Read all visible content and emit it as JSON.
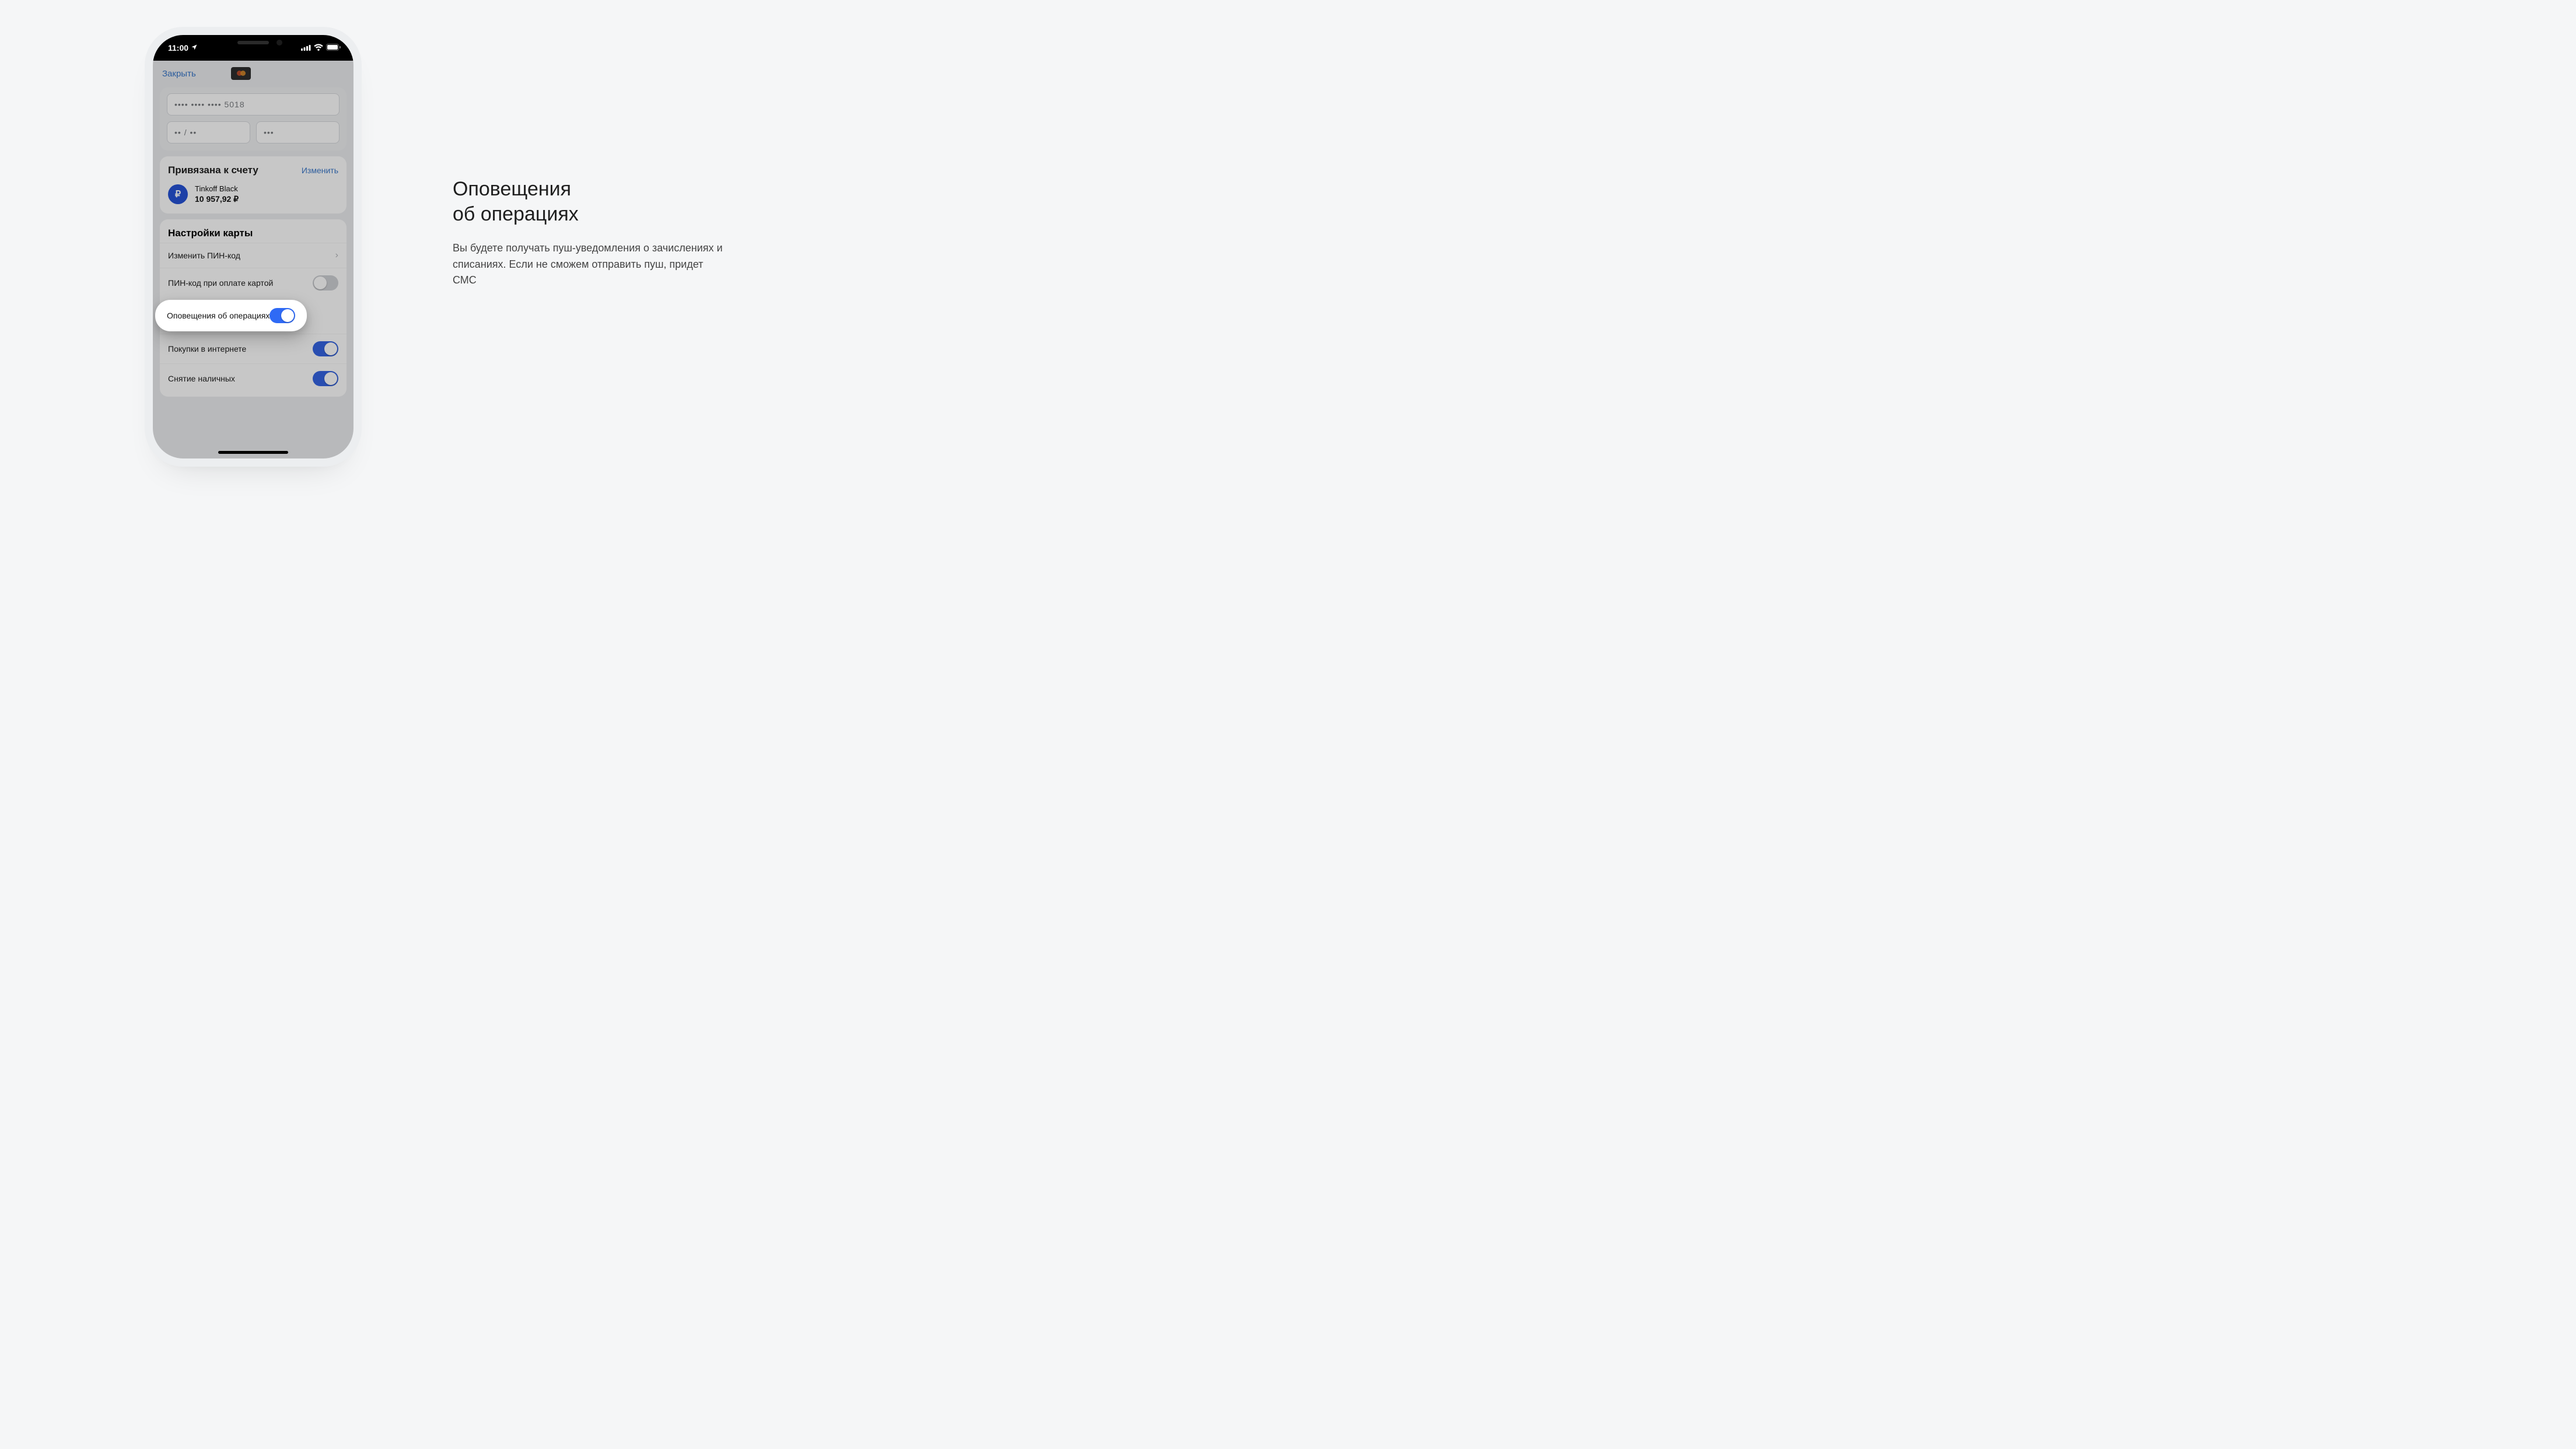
{
  "status_bar": {
    "time": "11:00"
  },
  "nav": {
    "close": "Закрыть"
  },
  "requisites": {
    "pan": "•••• •••• •••• 5018",
    "exp": "•• / ••",
    "cvc": "•••"
  },
  "linked": {
    "title": "Привязана к счету",
    "change": "Изменить",
    "account_name": "Tinkoff Black",
    "balance": "10 957,92 ₽",
    "currency_symbol": "₽"
  },
  "settings": {
    "title": "Настройки карты",
    "rows": {
      "change_pin": {
        "label": "Изменить ПИН-код",
        "type": "disclosure"
      },
      "pin_on_pay": {
        "label": "ПИН-код при оплате картой",
        "type": "toggle",
        "on": false
      },
      "tx_notifications": {
        "label": "Оповещения об операциях",
        "type": "toggle",
        "on": true,
        "highlighted": true
      },
      "online_purchases": {
        "label": "Покупки в интернете",
        "type": "toggle",
        "on": true
      },
      "cash_withdrawal": {
        "label": "Снятие наличных",
        "type": "toggle",
        "on": true
      }
    }
  },
  "callout": {
    "title_line1": "Оповещения",
    "title_line2": "об операциях",
    "body": "Вы будете получать пуш-уведомления о зачислениях и списаниях. Если не сможем отправить пуш, придет СМС"
  }
}
